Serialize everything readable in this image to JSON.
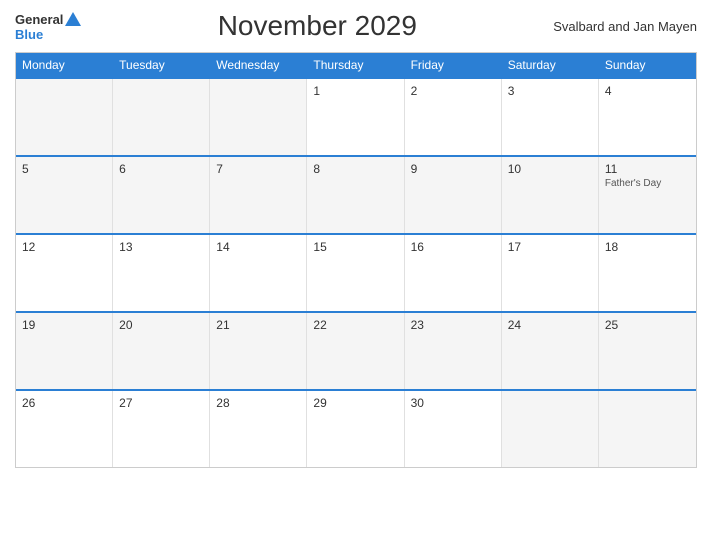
{
  "header": {
    "logo_general": "General",
    "logo_blue": "Blue",
    "title": "November 2029",
    "region": "Svalbard and Jan Mayen"
  },
  "days_of_week": [
    "Monday",
    "Tuesday",
    "Wednesday",
    "Thursday",
    "Friday",
    "Saturday",
    "Sunday"
  ],
  "weeks": [
    {
      "cells": [
        {
          "num": "",
          "empty": true
        },
        {
          "num": "",
          "empty": true
        },
        {
          "num": "",
          "empty": true
        },
        {
          "num": "1",
          "empty": false,
          "event": ""
        },
        {
          "num": "2",
          "empty": false,
          "event": ""
        },
        {
          "num": "3",
          "empty": false,
          "event": ""
        },
        {
          "num": "4",
          "empty": false,
          "event": ""
        }
      ]
    },
    {
      "cells": [
        {
          "num": "5",
          "empty": false,
          "event": ""
        },
        {
          "num": "6",
          "empty": false,
          "event": ""
        },
        {
          "num": "7",
          "empty": false,
          "event": ""
        },
        {
          "num": "8",
          "empty": false,
          "event": ""
        },
        {
          "num": "9",
          "empty": false,
          "event": ""
        },
        {
          "num": "10",
          "empty": false,
          "event": ""
        },
        {
          "num": "11",
          "empty": false,
          "event": "Father's Day"
        }
      ]
    },
    {
      "cells": [
        {
          "num": "12",
          "empty": false,
          "event": ""
        },
        {
          "num": "13",
          "empty": false,
          "event": ""
        },
        {
          "num": "14",
          "empty": false,
          "event": ""
        },
        {
          "num": "15",
          "empty": false,
          "event": ""
        },
        {
          "num": "16",
          "empty": false,
          "event": ""
        },
        {
          "num": "17",
          "empty": false,
          "event": ""
        },
        {
          "num": "18",
          "empty": false,
          "event": ""
        }
      ]
    },
    {
      "cells": [
        {
          "num": "19",
          "empty": false,
          "event": ""
        },
        {
          "num": "20",
          "empty": false,
          "event": ""
        },
        {
          "num": "21",
          "empty": false,
          "event": ""
        },
        {
          "num": "22",
          "empty": false,
          "event": ""
        },
        {
          "num": "23",
          "empty": false,
          "event": ""
        },
        {
          "num": "24",
          "empty": false,
          "event": ""
        },
        {
          "num": "25",
          "empty": false,
          "event": ""
        }
      ]
    },
    {
      "cells": [
        {
          "num": "26",
          "empty": false,
          "event": ""
        },
        {
          "num": "27",
          "empty": false,
          "event": ""
        },
        {
          "num": "28",
          "empty": false,
          "event": ""
        },
        {
          "num": "29",
          "empty": false,
          "event": ""
        },
        {
          "num": "30",
          "empty": false,
          "event": ""
        },
        {
          "num": "",
          "empty": true
        },
        {
          "num": "",
          "empty": true
        }
      ]
    }
  ]
}
